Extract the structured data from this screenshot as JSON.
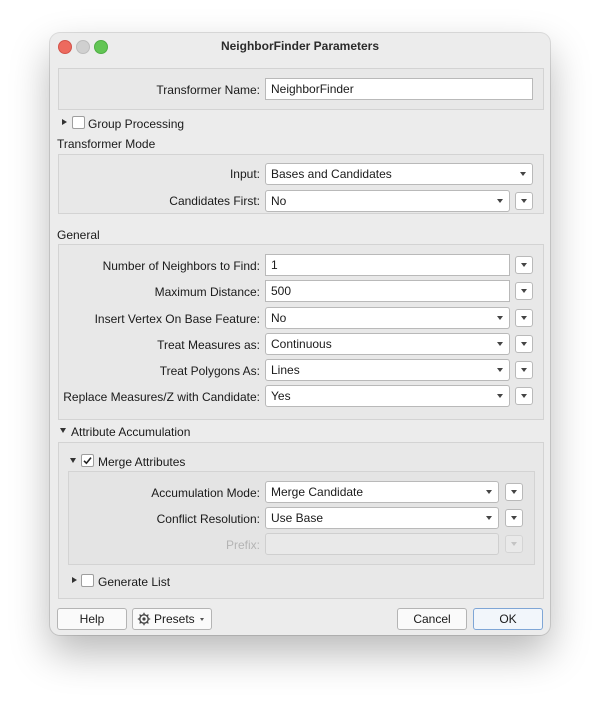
{
  "window": {
    "title": "NeighborFinder Parameters"
  },
  "transformer_name": {
    "label": "Transformer Name:",
    "value": "NeighborFinder"
  },
  "group_processing": {
    "label": "Group Processing",
    "checked": false
  },
  "transformer_mode": {
    "title": "Transformer Mode",
    "input": {
      "label": "Input:",
      "value": "Bases and Candidates"
    },
    "candidates_first": {
      "label": "Candidates First:",
      "value": "No"
    }
  },
  "general": {
    "title": "General",
    "neighbors": {
      "label": "Number of Neighbors to Find:",
      "value": "1"
    },
    "max_distance": {
      "label": "Maximum Distance:",
      "value": "500"
    },
    "insert_vertex": {
      "label": "Insert Vertex On Base Feature:",
      "value": "No"
    },
    "treat_measures": {
      "label": "Treat Measures as:",
      "value": "Continuous"
    },
    "treat_polygons": {
      "label": "Treat Polygons As:",
      "value": "Lines"
    },
    "replace_measures": {
      "label": "Replace Measures/Z with Candidate:",
      "value": "Yes"
    }
  },
  "attribute_accumulation": {
    "title": "Attribute Accumulation",
    "merge_attributes": {
      "label": "Merge Attributes",
      "checked": true
    },
    "accumulation_mode": {
      "label": "Accumulation Mode:",
      "value": "Merge Candidate"
    },
    "conflict_resolution": {
      "label": "Conflict Resolution:",
      "value": "Use Base"
    },
    "prefix": {
      "label": "Prefix:",
      "value": ""
    },
    "generate_list": {
      "label": "Generate List",
      "checked": false
    }
  },
  "footer": {
    "help": "Help",
    "presets": "Presets",
    "cancel": "Cancel",
    "ok": "OK"
  },
  "colors": {
    "close": "#ed6a5e",
    "maximize": "#62c554",
    "accent": "#7fa6d6"
  },
  "icons": [
    "checkmark-icon",
    "gear-icon",
    "disclosure-triangle-icon",
    "dropdown-caret-icon"
  ]
}
